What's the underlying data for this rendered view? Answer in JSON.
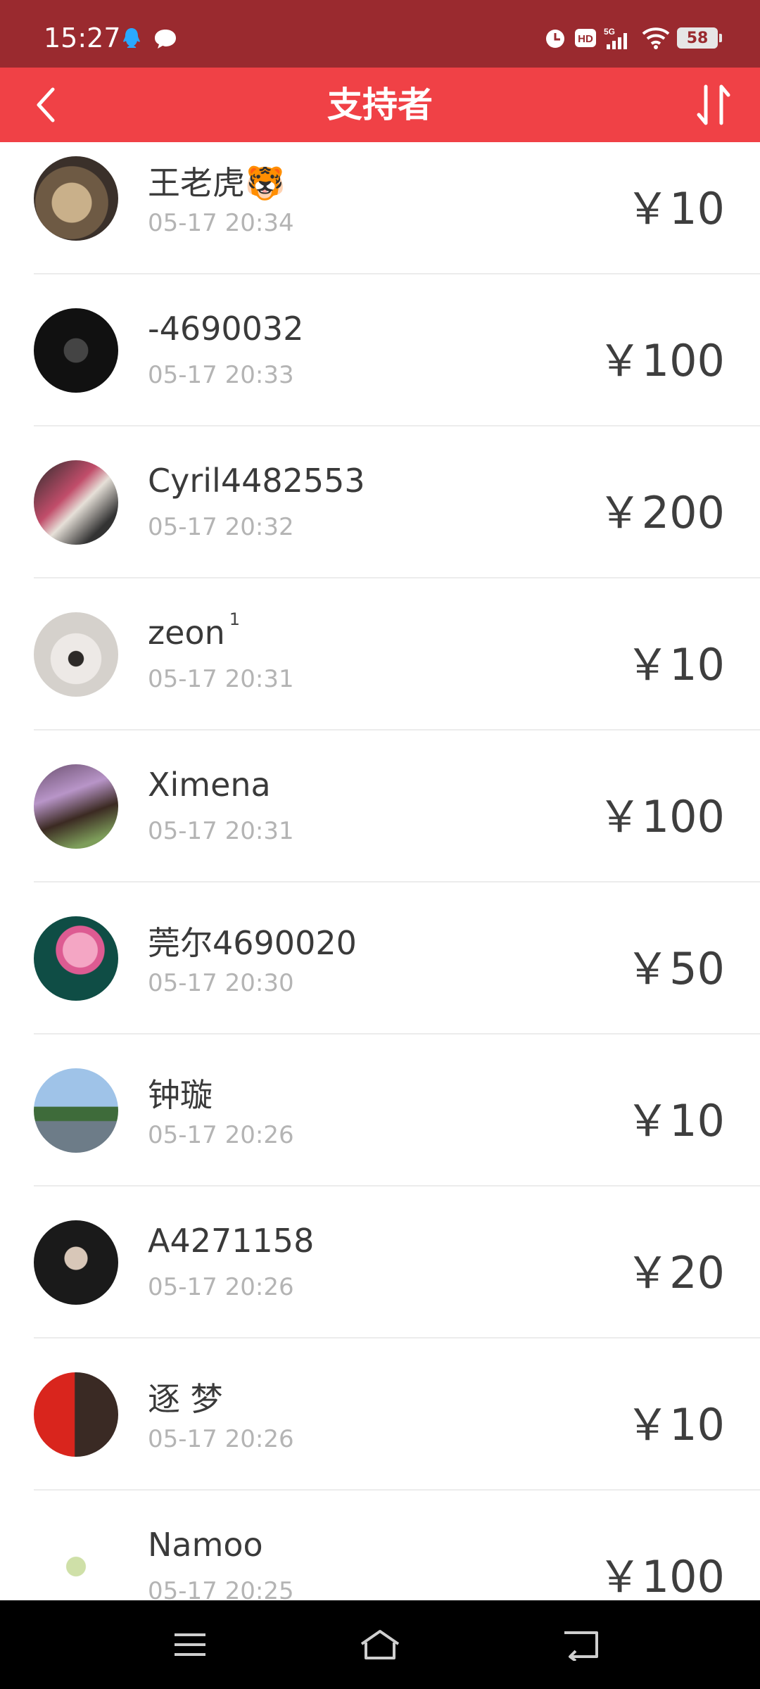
{
  "status_bar": {
    "time": "15:27",
    "battery": "58",
    "icons": [
      "qq-icon",
      "message-icon",
      "alarm-icon",
      "hd-icon",
      "5g-signal-icon",
      "wifi-icon",
      "battery-icon"
    ]
  },
  "header": {
    "title": "支持者",
    "back_icon": "chevron-left-icon",
    "sort_icon": "sort-icon",
    "background": "#f04146"
  },
  "supporters": [
    {
      "name": "王老虎🐯",
      "time": "05-17 20:34",
      "amount": "￥10"
    },
    {
      "name": "-4690032",
      "time": "05-17 20:33",
      "amount": "￥100"
    },
    {
      "name": "Cyril4482553",
      "time": "05-17 20:32",
      "amount": "￥200"
    },
    {
      "name": "zeon",
      "badge": "1",
      "time": "05-17 20:31",
      "amount": "￥10"
    },
    {
      "name": "Ximena",
      "time": "05-17 20:31",
      "amount": "￥100"
    },
    {
      "name": "莞尔4690020",
      "time": "05-17 20:30",
      "amount": "￥50"
    },
    {
      "name": "钟璇",
      "time": "05-17 20:26",
      "amount": "￥10"
    },
    {
      "name": "A4271158",
      "time": "05-17 20:26",
      "amount": "￥20"
    },
    {
      "name": "  逐  梦",
      "time": "05-17 20:26",
      "amount": "￥10"
    },
    {
      "name": "Namoo",
      "time": "05-17 20:25",
      "amount": "￥100"
    }
  ],
  "nav_bar": {
    "icons": [
      "menu-icon",
      "home-icon",
      "back-icon"
    ]
  }
}
